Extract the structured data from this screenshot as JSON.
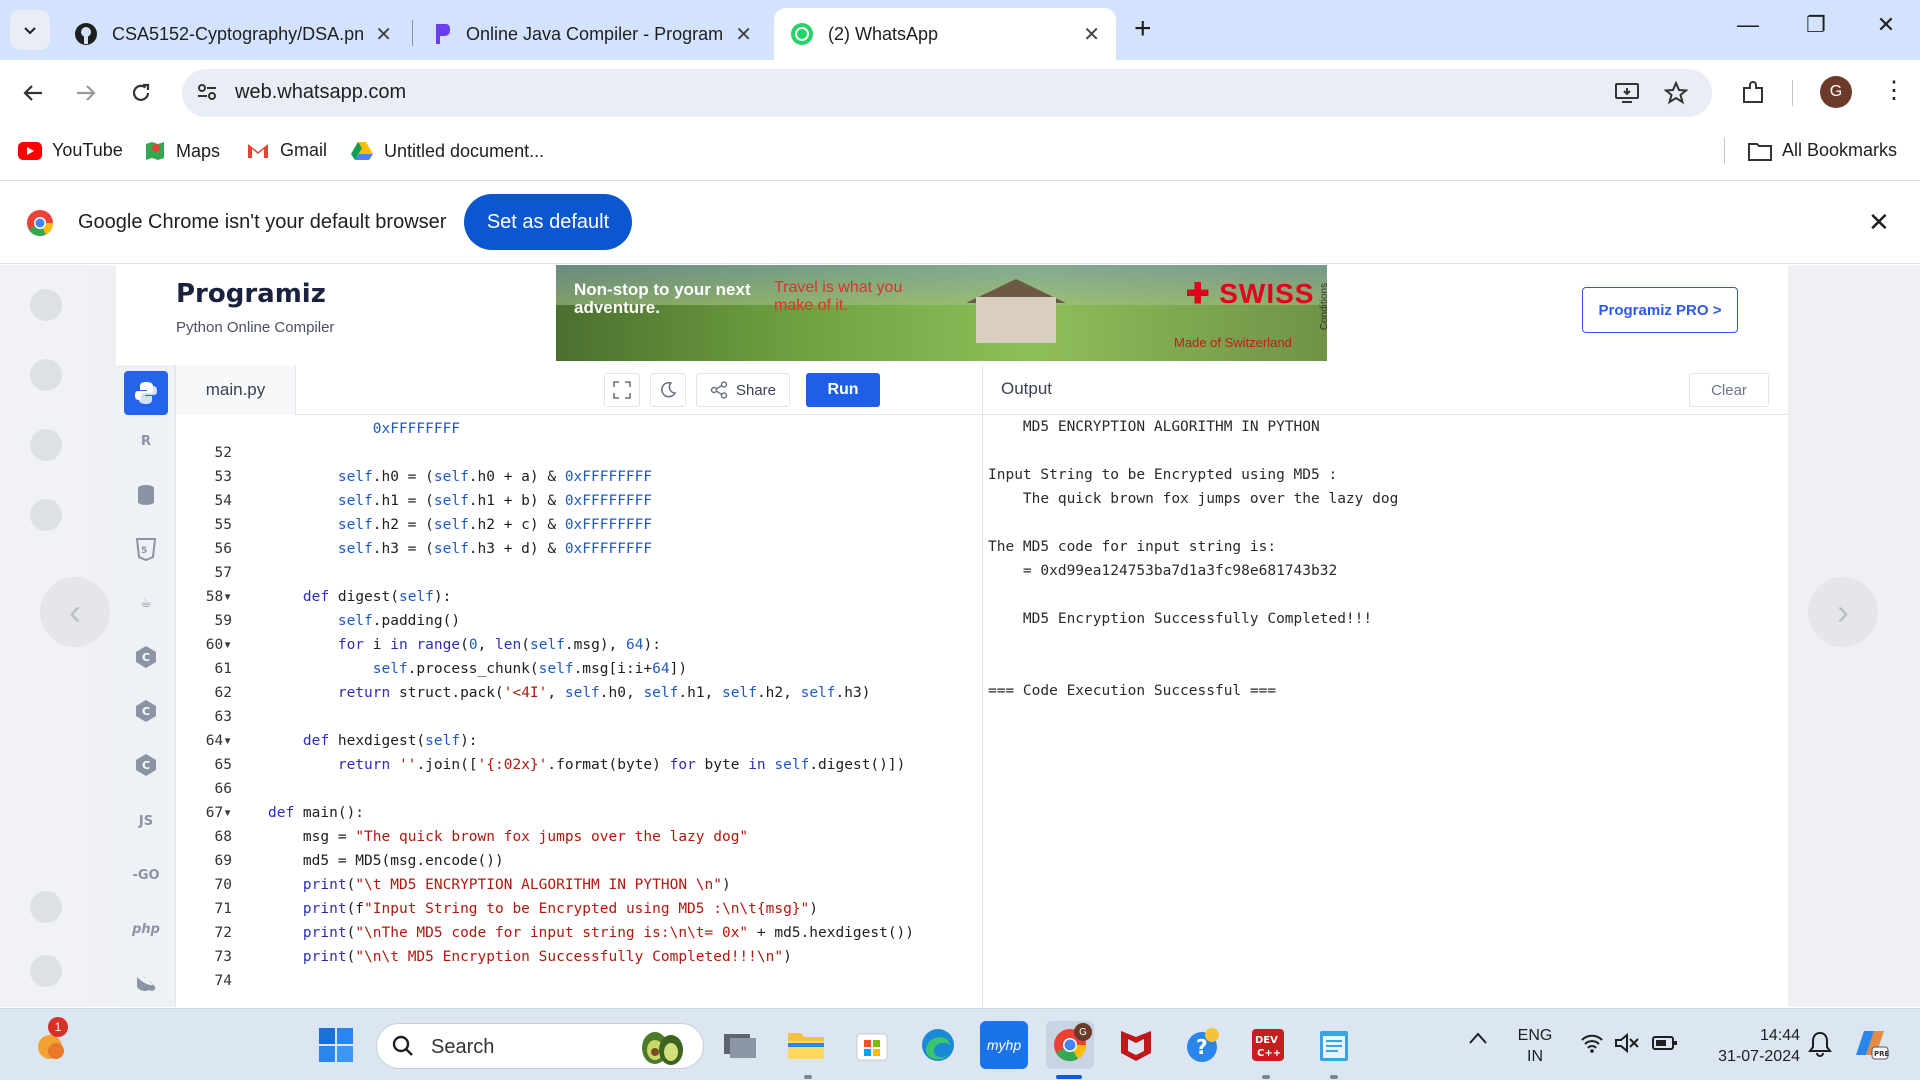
{
  "browser": {
    "tabs": [
      {
        "title": "CSA5152-Cyptography/DSA.pn",
        "favicon": "github-icon"
      },
      {
        "title": "Online Java Compiler - Program",
        "favicon": "programiz-icon"
      },
      {
        "title": "(2) WhatsApp",
        "favicon": "whatsapp-icon"
      }
    ],
    "url": "web.whatsapp.com",
    "profile_initial": "G",
    "bookmarks": [
      {
        "label": "YouTube",
        "icon": "youtube-icon"
      },
      {
        "label": "Maps",
        "icon": "maps-icon"
      },
      {
        "label": "Gmail",
        "icon": "gmail-icon"
      },
      {
        "label": "Untitled document...",
        "icon": "drive-icon"
      }
    ],
    "all_bookmarks": "All Bookmarks"
  },
  "infobar": {
    "message": "Google Chrome isn't your default browser",
    "button": "Set as default"
  },
  "programiz": {
    "logo": "Programiz",
    "subtitle": "Python Online Compiler",
    "ad": {
      "headline": "Non-stop to your next adventure.",
      "tagline": "Travel is what you make of it.",
      "brand": "SWISS",
      "made": "Made of Switzerland",
      "conditions": "Conditions"
    },
    "pro_button": "Programiz PRO >",
    "lang_icons": [
      "python",
      "R",
      "SQL",
      "HTML",
      "Java",
      "C",
      "C++",
      "C#",
      "JS",
      "GO",
      "php",
      "Swift"
    ],
    "file_tab": "main.py",
    "share_label": "Share",
    "run_label": "Run",
    "output_title": "Output",
    "clear_label": "Clear"
  },
  "code_lines": [
    {
      "n": "",
      "text": "            0xFFFFFFFF"
    },
    {
      "n": "52",
      "text": ""
    },
    {
      "n": "53",
      "text": "        self.h0 = (self.h0 + a) & 0xFFFFFFFF"
    },
    {
      "n": "54",
      "text": "        self.h1 = (self.h1 + b) & 0xFFFFFFFF"
    },
    {
      "n": "55",
      "text": "        self.h2 = (self.h2 + c) & 0xFFFFFFFF"
    },
    {
      "n": "56",
      "text": "        self.h3 = (self.h3 + d) & 0xFFFFFFFF"
    },
    {
      "n": "57",
      "text": ""
    },
    {
      "n": "58▾",
      "text": "    def digest(self):"
    },
    {
      "n": "59",
      "text": "        self.padding()"
    },
    {
      "n": "60▾",
      "text": "        for i in range(0, len(self.msg), 64):"
    },
    {
      "n": "61",
      "text": "            self.process_chunk(self.msg[i:i+64])"
    },
    {
      "n": "62",
      "text": "        return struct.pack('<4I', self.h0, self.h1, self.h2, self.h3)"
    },
    {
      "n": "63",
      "text": ""
    },
    {
      "n": "64▾",
      "text": "    def hexdigest(self):"
    },
    {
      "n": "65",
      "text": "        return ''.join(['{:02x}'.format(byte) for byte in self.digest()])"
    },
    {
      "n": "66",
      "text": ""
    },
    {
      "n": "67▾",
      "text": "def main():"
    },
    {
      "n": "68",
      "text": "    msg = \"The quick brown fox jumps over the lazy dog\""
    },
    {
      "n": "69",
      "text": "    md5 = MD5(msg.encode())"
    },
    {
      "n": "70",
      "text": "    print(\"\\t MD5 ENCRYPTION ALGORITHM IN PYTHON \\n\")"
    },
    {
      "n": "71",
      "text": "    print(f\"Input String to be Encrypted using MD5 :\\n\\t{msg}\")"
    },
    {
      "n": "72",
      "text": "    print(\"\\nThe MD5 code for input string is:\\n\\t= 0x\" + md5.hexdigest())"
    },
    {
      "n": "73",
      "text": "    print(\"\\n\\t MD5 Encryption Successfully Completed!!!\\n\")"
    },
    {
      "n": "74",
      "text": ""
    }
  ],
  "output_lines": [
    "    MD5 ENCRYPTION ALGORITHM IN PYTHON",
    "",
    "Input String to be Encrypted using MD5 :",
    "    The quick brown fox jumps over the lazy dog",
    "",
    "The MD5 code for input string is:",
    "    = 0xd99ea124753ba7d1a3fc98e681743b32",
    "",
    "    MD5 Encryption Successfully Completed!!!",
    "",
    "",
    "=== Code Execution Successful ==="
  ],
  "taskbar": {
    "search_placeholder": "Search",
    "weather_badge": "1",
    "chrome_badge": "G",
    "lang_line1": "ENG",
    "lang_line2": "IN",
    "time": "14:44",
    "date": "31-07-2024"
  }
}
